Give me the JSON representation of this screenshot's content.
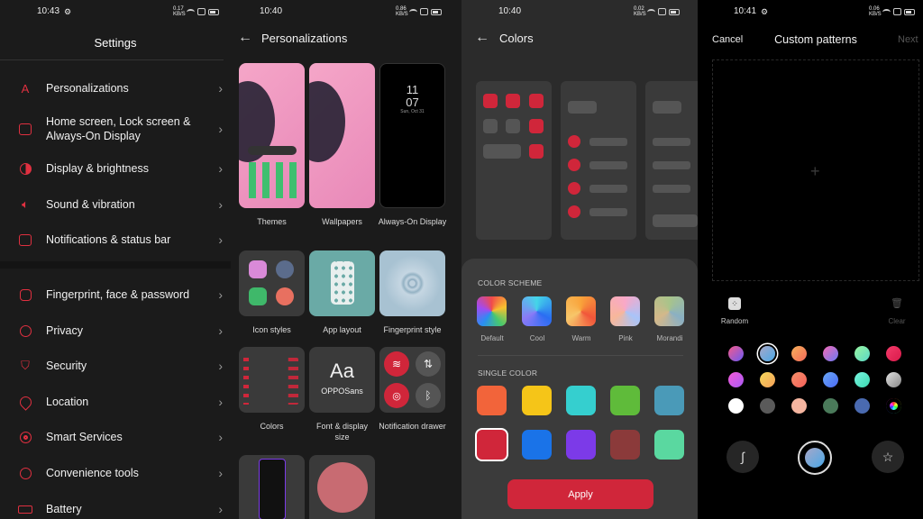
{
  "settings": {
    "time": "10:43",
    "net": "0.17 KB/S",
    "title": "Settings",
    "items": [
      {
        "label": "Personalizations",
        "icon": "personalization-icon"
      },
      {
        "label": "Home screen, Lock screen & Always-On Display",
        "icon": "home-screen-icon"
      },
      {
        "label": "Display & brightness",
        "icon": "brightness-icon"
      },
      {
        "label": "Sound & vibration",
        "icon": "sound-icon"
      },
      {
        "label": "Notifications & status bar",
        "icon": "notification-icon"
      },
      {
        "label": "Fingerprint, face & password",
        "icon": "lock-icon"
      },
      {
        "label": "Privacy",
        "icon": "privacy-icon"
      },
      {
        "label": "Security",
        "icon": "shield-icon"
      },
      {
        "label": "Location",
        "icon": "location-icon"
      },
      {
        "label": "Smart Services",
        "icon": "smart-services-icon"
      },
      {
        "label": "Convenience tools",
        "icon": "convenience-icon"
      },
      {
        "label": "Battery",
        "icon": "battery-icon"
      }
    ]
  },
  "personalizations": {
    "time": "10:40",
    "net": "0.86 KB/S",
    "title": "Personalizations",
    "aod_time_hour": "11",
    "aod_time_min": "07",
    "aod_date": "Sun, Oct 31",
    "font_sample": "Aa",
    "font_name": "OPPOSans",
    "tiles": {
      "themes": "Themes",
      "wallpapers": "Wallpapers",
      "aod": "Always-On Display",
      "icon_styles": "Icon styles",
      "app_layout": "App layout",
      "fingerprint": "Fingerprint style",
      "colors": "Colors",
      "font": "Font & display size",
      "notif": "Notification drawer"
    }
  },
  "colors": {
    "time": "10:40",
    "net": "0.02 KB/S",
    "title": "Colors",
    "scheme_title": "COLOR SCHEME",
    "schemes": [
      "Default",
      "Cool",
      "Warm",
      "Pink",
      "Morandi"
    ],
    "single_title": "SINGLE COLOR",
    "single_colors": [
      "#f2643a",
      "#f5c518",
      "#35cfcf",
      "#5fbb3a",
      "#4a9ab8",
      "#d0263a",
      "#1a73e8",
      "#7c3ae8",
      "#8b3a3a",
      "#5ad8a0"
    ],
    "apply": "Apply",
    "accent": "#d0263a"
  },
  "custom": {
    "time": "10:41",
    "net": "0.06 KB/S",
    "cancel": "Cancel",
    "title": "Custom patterns",
    "next": "Next",
    "random": "Random",
    "clear": "Clear"
  }
}
